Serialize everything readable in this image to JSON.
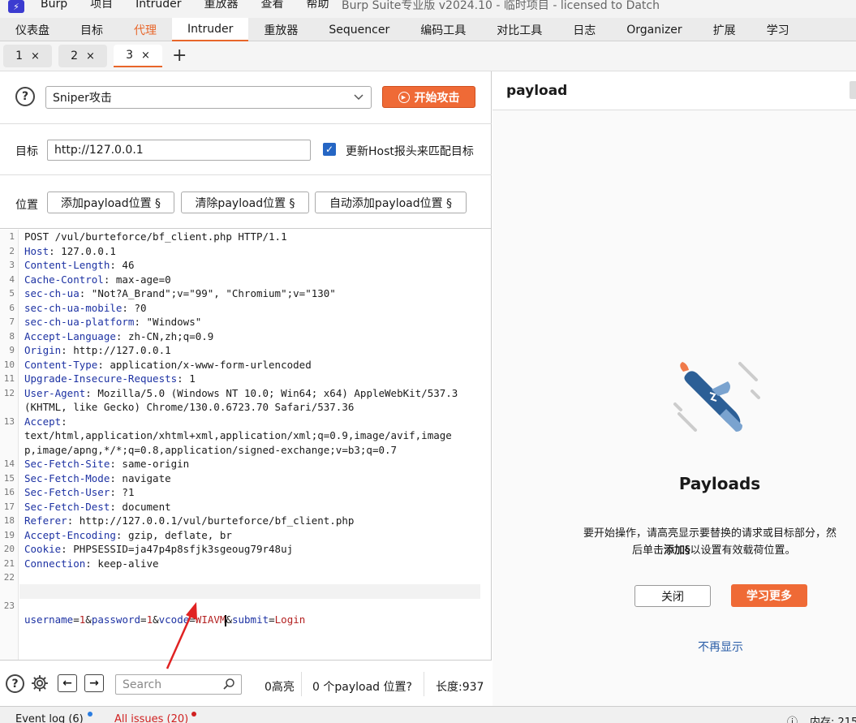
{
  "app": {
    "logo": "⚡",
    "menu": [
      "Burp",
      "项目",
      "Intruder",
      "重放器",
      "查看",
      "帮助"
    ],
    "window_title": "Burp Suite专业版  v2024.10 - 临时项目 - licensed to Datch"
  },
  "main_tabs": [
    {
      "label": "仪表盘"
    },
    {
      "label": "目标"
    },
    {
      "label": "代理"
    },
    {
      "label": "Intruder"
    },
    {
      "label": "重放器"
    },
    {
      "label": "Sequencer"
    },
    {
      "label": "编码工具"
    },
    {
      "label": "对比工具"
    },
    {
      "label": "日志"
    },
    {
      "label": "Organizer"
    },
    {
      "label": "扩展"
    },
    {
      "label": "学习"
    }
  ],
  "sub_tabs": [
    {
      "label": "1",
      "close": "×"
    },
    {
      "label": "2",
      "close": "×"
    },
    {
      "label": "3",
      "close": "×"
    }
  ],
  "sub_tab_add": "+",
  "attack": {
    "help": "?",
    "type_value": "Sniper攻击",
    "start_label": "开始攻击"
  },
  "target": {
    "label": "目标",
    "value": "http://127.0.0.1",
    "checkbox_checked": true,
    "checkbox_label": "更新Host报头来匹配目标"
  },
  "positions": {
    "label": "位置",
    "add_label": "添加payload位置 §",
    "clear_label": "清除payload位置 §",
    "auto_label": "自动添加payload位置 §"
  },
  "request_lines": [
    {
      "n": "1",
      "key": "",
      "val": "POST /vul/burteforce/bf_client.php HTTP/1.1"
    },
    {
      "n": "2",
      "key": "Host",
      "val": " 127.0.0.1"
    },
    {
      "n": "3",
      "key": "Content-Length",
      "val": " 46"
    },
    {
      "n": "4",
      "key": "Cache-Control",
      "val": " max-age=0"
    },
    {
      "n": "5",
      "key": "sec-ch-ua",
      "val": " \"Not?A_Brand\";v=\"99\", \"Chromium\";v=\"130\""
    },
    {
      "n": "6",
      "key": "sec-ch-ua-mobile",
      "val": " ?0"
    },
    {
      "n": "7",
      "key": "sec-ch-ua-platform",
      "val": " \"Windows\""
    },
    {
      "n": "8",
      "key": "Accept-Language",
      "val": " zh-CN,zh;q=0.9"
    },
    {
      "n": "9",
      "key": "Origin",
      "val": " http://127.0.0.1"
    },
    {
      "n": "10",
      "key": "Content-Type",
      "val": " application/x-www-form-urlencoded"
    },
    {
      "n": "11",
      "key": "Upgrade-Insecure-Requests",
      "val": " 1"
    },
    {
      "n": "12",
      "key": "User-Agent",
      "val": " Mozilla/5.0 (Windows NT 10.0; Win64; x64) AppleWebKit/537.3"
    },
    {
      "n": "",
      "key": "",
      "val": "(KHTML, like Gecko) Chrome/130.0.6723.70 Safari/537.36"
    },
    {
      "n": "13",
      "key": "Accept",
      "val": ""
    },
    {
      "n": "",
      "key": "",
      "val": "text/html,application/xhtml+xml,application/xml;q=0.9,image/avif,image"
    },
    {
      "n": "",
      "key": "",
      "val": "p,image/apng,*/*;q=0.8,application/signed-exchange;v=b3;q=0.7"
    },
    {
      "n": "14",
      "key": "Sec-Fetch-Site",
      "val": " same-origin"
    },
    {
      "n": "15",
      "key": "Sec-Fetch-Mode",
      "val": " navigate"
    },
    {
      "n": "16",
      "key": "Sec-Fetch-User",
      "val": " ?1"
    },
    {
      "n": "17",
      "key": "Sec-Fetch-Dest",
      "val": " document"
    },
    {
      "n": "18",
      "key": "Referer",
      "val": " http://127.0.0.1/vul/burteforce/bf_client.php"
    },
    {
      "n": "19",
      "key": "Accept-Encoding",
      "val": " gzip, deflate, br"
    },
    {
      "n": "20",
      "key": "Cookie",
      "val": " PHPSESSID=ja47p4p8sfjk3sgeoug79r48uj"
    },
    {
      "n": "21",
      "key": "Connection",
      "val": " keep-alive"
    },
    {
      "n": "22",
      "key": "",
      "val": ""
    }
  ],
  "body_line": {
    "n": "23",
    "params": [
      {
        "k": "username",
        "v": "1",
        "sep": "&"
      },
      {
        "k": "password",
        "v": "1",
        "sep": "&"
      },
      {
        "k": "vcode",
        "v": "WIAVM",
        "sep": "&"
      },
      {
        "k": "submit",
        "v": "Login",
        "sep": ""
      }
    ]
  },
  "editor_toolbar": {
    "search_placeholder": "Search",
    "highlights": "0高亮",
    "payload_positions": "0 个payload 位置?",
    "length": "长度:937"
  },
  "payload_panel": {
    "title": "payload",
    "heading": "Payloads",
    "desc_line1": "要开始操作，请高亮显示要替换的请求或目标部分，然",
    "desc_line2_pre": "后单击",
    "desc_line2_bold": "添加§",
    "desc_line2_post": "以设置有效载荷位置。",
    "close_label": "关闭",
    "learn_label": "学习更多",
    "dont_show_label": "不再显示"
  },
  "statusbar": {
    "event_log": "Event log (6)",
    "issues": "All issues (20)",
    "memory": "内存: 215"
  },
  "colors": {
    "accent": "#ef6a36",
    "tab_orange": "#e8662a",
    "header_key": "#1d32a3",
    "param_value": "#b32020",
    "link": "#2b5ea8",
    "annotation": "#e02222"
  }
}
